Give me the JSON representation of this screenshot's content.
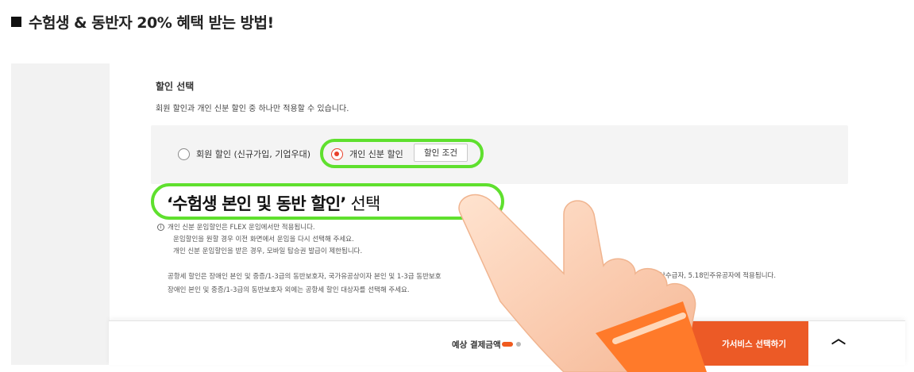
{
  "header": {
    "title": "수험생 & 동반자 20% 혜택 받는 방법!"
  },
  "discount": {
    "section_title": "할인 선택",
    "description": "회원 할인과 개인 신분 할인 중 하나만 적용할 수 있습니다.",
    "options": [
      {
        "label": "회원 할인 (신규가입, 기업우대)",
        "selected": false
      },
      {
        "label": "개인 신분 할인",
        "selected": true
      }
    ],
    "condition_button": "할인 조건"
  },
  "callout": {
    "bold_text": "‘수험생 본인 및 동반 할인’",
    "suffix": " 선택"
  },
  "notes": {
    "line1": "개인 신분 운임할인은 FLEX 운임에서만 적용됩니다.",
    "line2": "운임할인을 원할 경우 이전 화면에서 운임을 다시 선택해 주세요.",
    "line3": "개인 신분 운임할인을 받은 경우, 모바일 탑승권 발급이 제한됩니다.",
    "line4": "공항세 할인은 장애인 본인 및 중증/1-3급의 동반보호자, 국가유공상이자 본인 및 1-3급 동반보호",
    "line4_tail": "상수급자, 5.18민주유공자에 적용됩니다.",
    "line5": "장애인 본인 및 중증/1-3급의 동반보호자 외에는 공항세 할인 대상자를 선택해 주세요."
  },
  "bottom_bar": {
    "pay_label": "예상 결제금액",
    "cta_label": "가서비스 선택하기"
  },
  "colors": {
    "accent": "#ec5a26",
    "highlight": "#5fe02e",
    "radio_selected": "#e8402a"
  },
  "icons": {
    "info": "info-icon",
    "expand": "chevron-up-icon",
    "pointer": "pointing-hand"
  }
}
